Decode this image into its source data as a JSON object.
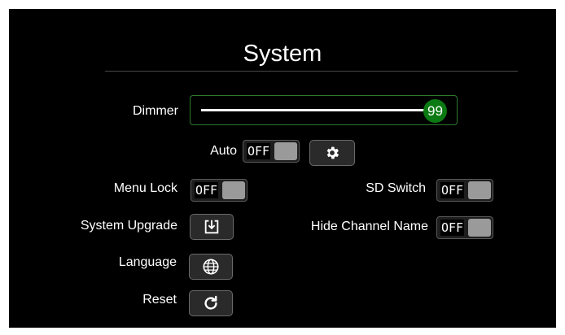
{
  "title": "System",
  "dimmer": {
    "label": "Dimmer",
    "value": 99,
    "value_text": "99",
    "accent": "#0c7a12"
  },
  "auto": {
    "label": "Auto",
    "state": "OFF"
  },
  "auto_settings": {
    "icon": "gear-icon"
  },
  "menu_lock": {
    "label": "Menu Lock",
    "state": "OFF"
  },
  "sd_switch": {
    "label": "SD Switch",
    "state": "OFF"
  },
  "system_upgrade": {
    "label": "System Upgrade",
    "icon": "download-icon"
  },
  "hide_channel_name": {
    "label": "Hide Channel Name",
    "state": "OFF"
  },
  "language": {
    "label": "Language",
    "icon": "globe-icon"
  },
  "reset": {
    "label": "Reset",
    "icon": "reset-icon"
  }
}
